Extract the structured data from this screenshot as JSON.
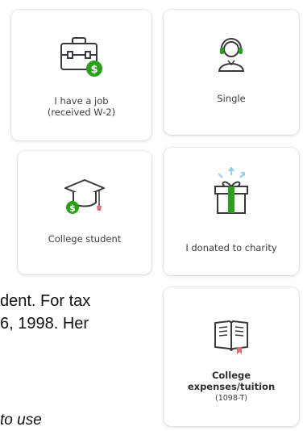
{
  "cards": {
    "job": {
      "line1": "I have a job",
      "line2": "(received W-2)",
      "icon": "briefcase-dollar-icon"
    },
    "single": {
      "label": "Single",
      "icon": "person-headset-icon"
    },
    "student": {
      "label": "College student",
      "icon": "graduation-cap-dollar-icon"
    },
    "charity": {
      "label": "I donated to charity",
      "icon": "gift-box-icon"
    },
    "college": {
      "line1": "College",
      "line2": "expenses/tuition",
      "line3": "(1098-T)",
      "icon": "open-book-icon"
    }
  },
  "background_text": {
    "line1": "dent. For tax",
    "line2": "6, 1998. Her",
    "line3": "to use"
  },
  "colors": {
    "accent_green": "#2ca01c",
    "icon_outline": "#393a3d",
    "ribbon_red": "#e76b72",
    "sparkle_blue": "#8fd0e3"
  }
}
